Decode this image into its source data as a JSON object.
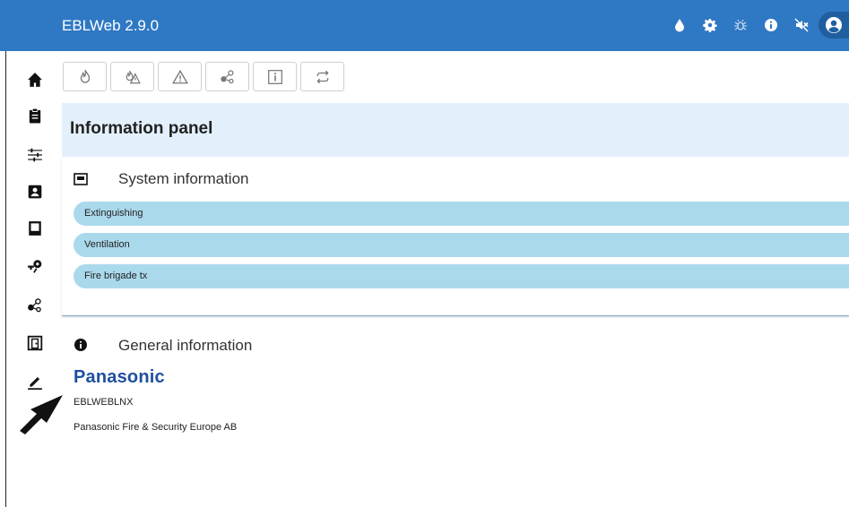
{
  "app": {
    "title": "EBLWeb 2.9.0"
  },
  "header_icons": [
    "water-drop-icon",
    "gear-icon",
    "bug-icon",
    "info-icon",
    "mute-icon",
    "user-icon"
  ],
  "sidebar": {
    "items": [
      "home-icon",
      "clipboard-icon",
      "sliders-icon",
      "contact-card-icon",
      "panel-icon",
      "key-icon",
      "network-icon",
      "door-icon",
      "pen-icon"
    ]
  },
  "toolbar": {
    "buttons": [
      "fire-icon",
      "fire-warning-icon",
      "warning-icon",
      "network-icon",
      "info-box-icon",
      "repeat-icon"
    ]
  },
  "panel": {
    "title": "Information panel"
  },
  "system_info": {
    "title": "System information",
    "items": [
      "Extinguishing",
      "Ventilation",
      "Fire brigade tx"
    ]
  },
  "general_info": {
    "title": "General information",
    "brand": "Panasonic",
    "product": "EBLWEBLNX",
    "company": "Panasonic Fire & Security Europe AB"
  },
  "colors": {
    "header": "#2f78c4",
    "panel_bg": "#e3f0fb",
    "pill": "#abd9ec",
    "brand": "#1f4fa0"
  }
}
